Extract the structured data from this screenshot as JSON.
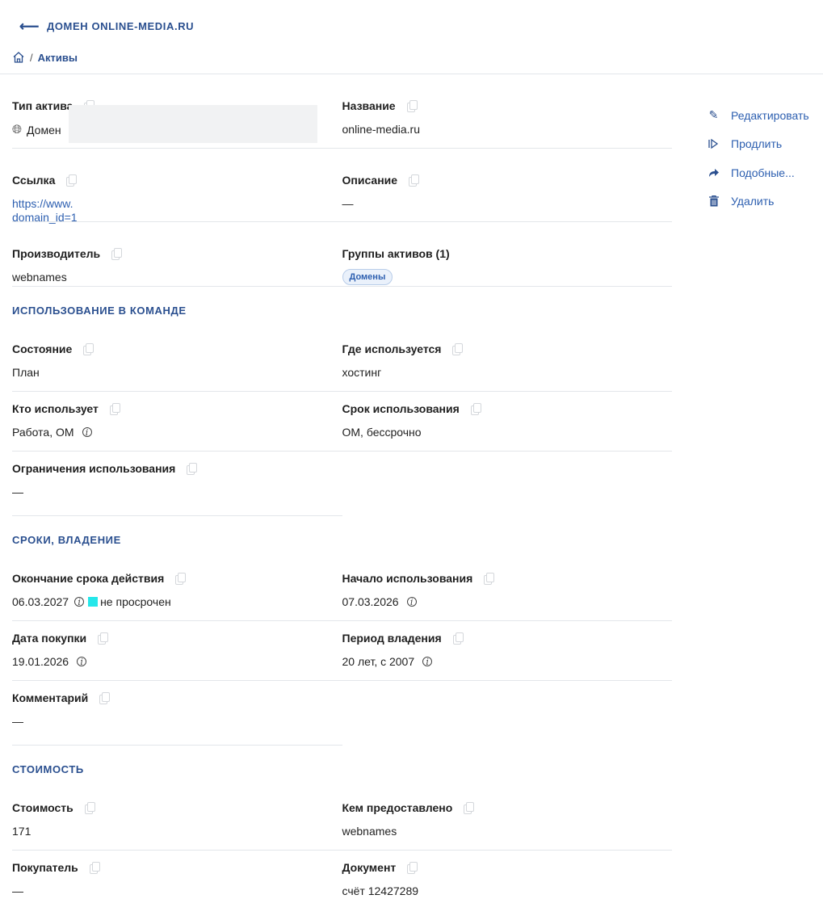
{
  "header": {
    "back_label": "ДОМЕН ONLINE-MEDIA.RU",
    "breadcrumb": "Активы"
  },
  "actions": [
    {
      "label": "Редактировать",
      "icon": "pencil-icon"
    },
    {
      "label": "Продлить",
      "icon": "play-outline-icon"
    },
    {
      "label": "Подобные...",
      "icon": "share-arrow-icon"
    },
    {
      "label": "Удалить",
      "icon": "trash-icon"
    }
  ],
  "general": {
    "asset_type_label": "Тип актива",
    "asset_type_value": "Домен",
    "name_label": "Название",
    "name_value": "online-media.ru",
    "link_label": "Ссылка",
    "link_line1": "https://www.",
    "link_line2": "domain_id=1",
    "description_label": "Описание",
    "description_value": "—",
    "vendor_label": "Производитель",
    "vendor_value": "webnames",
    "groups_label": "Группы активов (1)",
    "groups_chip": "Домены"
  },
  "usage": {
    "title": "ИСПОЛЬЗОВАНИЕ В КОМАНДЕ",
    "state_label": "Состояние",
    "state_value": "План",
    "where_label": "Где используется",
    "where_value": "хостинг",
    "who_label": "Кто использует",
    "who_value": "Работа, ОМ",
    "term_label": "Срок использования",
    "term_value": "ОМ, бессрочно",
    "limits_label": "Ограничения использования",
    "limits_value": "—"
  },
  "ownership": {
    "title": "СРОКИ, ВЛАДЕНИЕ",
    "expiry_label": "Окончание срока действия",
    "expiry_value": "06.03.2027",
    "expiry_status": "не просрочен",
    "status_color": "#25e7ea",
    "start_label": "Начало использования",
    "start_value": "07.03.2026",
    "purchase_label": "Дата покупки",
    "purchase_value": "19.01.2026",
    "period_label": "Период владения",
    "period_value": "20 лет, с 2007",
    "comment_label": "Комментарий",
    "comment_value": "—"
  },
  "cost": {
    "title": "СТОИМОСТЬ",
    "cost_label": "Стоимость",
    "cost_value": "171",
    "provider_label": "Кем предоставлено",
    "provider_value": "webnames",
    "buyer_label": "Покупатель",
    "buyer_value": "—",
    "document_label": "Документ",
    "document_value": "счёт 12427289"
  }
}
